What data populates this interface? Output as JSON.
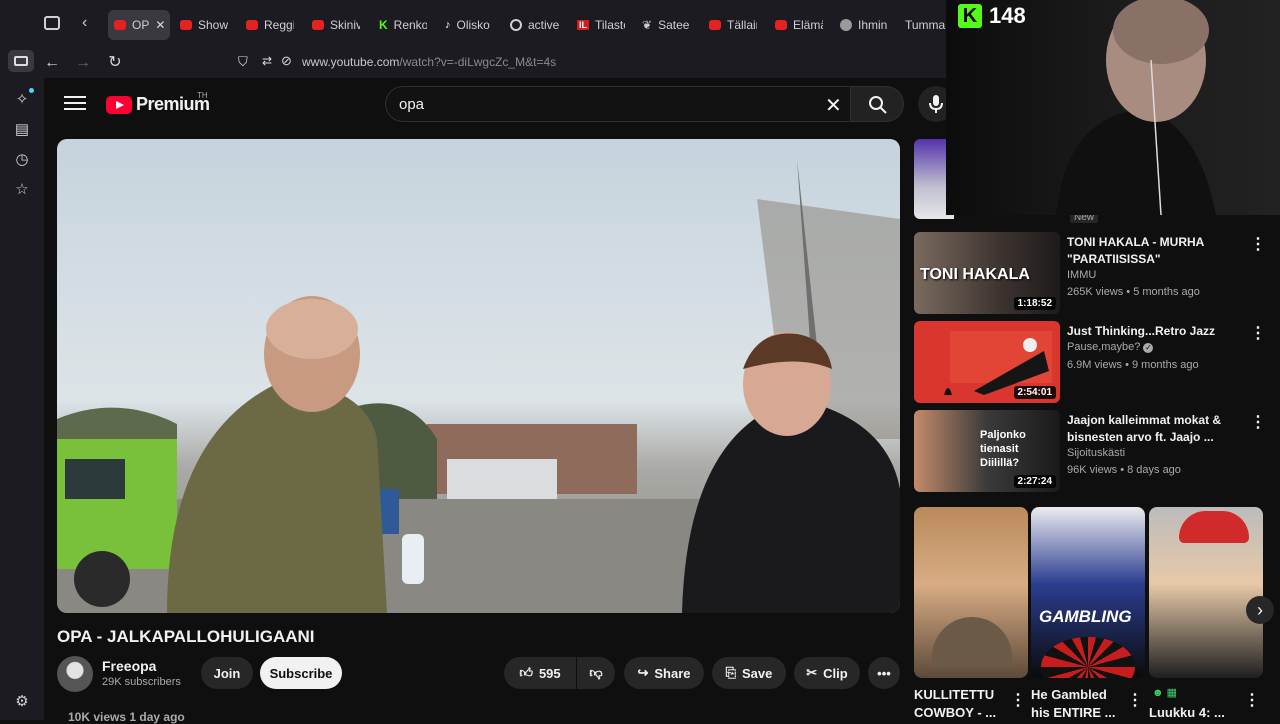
{
  "browser": {
    "tabs": [
      {
        "label": "OP",
        "active": true
      },
      {
        "label": "Show"
      },
      {
        "label": "Reggi"
      },
      {
        "label": "Skiniv"
      },
      {
        "label": "Renko"
      },
      {
        "label": "Olisko"
      },
      {
        "label": "active"
      },
      {
        "label": "Tilasto"
      },
      {
        "label": "Sateer"
      },
      {
        "label": "Tällain"
      },
      {
        "label": "Elämä"
      },
      {
        "label": "Ihmin"
      },
      {
        "label": "Tumma S"
      }
    ],
    "close_glyph": "✕",
    "url_main": "www.youtube.com",
    "url_rest": "/watch?v=-diLwgcZc_M&t=4s"
  },
  "youtube": {
    "logo_text": "Premium",
    "country": "TH",
    "search_value": "opa",
    "video": {
      "title": "OPA - JALKAPALLOHULIGAANI",
      "channel": "Freeopa",
      "subscribers": "29K subscribers",
      "join_label": "Join",
      "subscribe_label": "Subscribe",
      "likes": "595",
      "share_label": "Share",
      "save_label": "Save",
      "clip_label": "Clip",
      "views_line": "10K views  1 day ago"
    },
    "new_badge": "New",
    "recommendations": [
      {
        "title": "TONI HAKALA -  MURHA \"PARATIISISSA\"",
        "channel": "IMMU",
        "meta": "265K views • 5 months ago",
        "duration": "1:18:52",
        "thumb_text": "TONI HAKALA"
      },
      {
        "title": "Just Thinking...Retro Jazz",
        "channel": "Pause,maybe?",
        "meta": "6.9M views • 9 months ago",
        "duration": "2:54:01",
        "thumb_text": ""
      },
      {
        "title": "Jaajon kalleimmat mokat & bisnesten arvo ft. Jaajo ...",
        "channel": "Sijoituskästi",
        "meta": "96K views • 8 days ago",
        "duration": "2:27:24",
        "thumb_text": "Paljonko tienasit Diilillä?"
      }
    ],
    "shorts": [
      {
        "title": "KULLITETTU COWBOY - ..."
      },
      {
        "title": "He Gambled his ENTIRE ...",
        "thumb_text": "GAMBLING"
      },
      {
        "title": "Luukku 4: ..."
      }
    ]
  },
  "stream": {
    "kick_viewers": "148",
    "kick_logo": "K"
  }
}
